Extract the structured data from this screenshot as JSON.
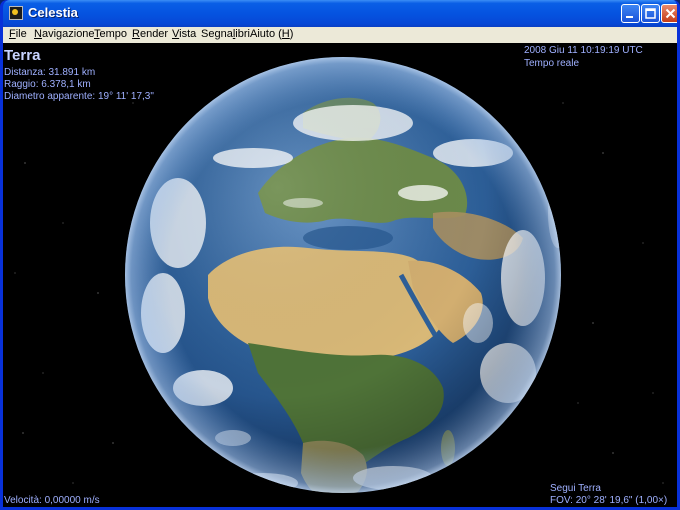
{
  "window": {
    "title": "Celestia",
    "buttons": {
      "minimize": "minimize-icon",
      "maximize": "maximize-icon",
      "close": "close-icon"
    }
  },
  "menu": {
    "items": [
      {
        "label": "File",
        "accel": "F"
      },
      {
        "label": "Navigazione",
        "accel": "N"
      },
      {
        "label": "Tempo",
        "accel": "T"
      },
      {
        "label": "Render",
        "accel": "R"
      },
      {
        "label": "Vista",
        "accel": "V"
      },
      {
        "label": "Segnalibri",
        "accel": "l"
      },
      {
        "label": "Aiuto (H)",
        "accel": "H"
      }
    ]
  },
  "hud": {
    "object_name": "Terra",
    "distance": "Distanza: 31.891 km",
    "radius": "Raggio: 6.378,1 km",
    "apparent_diameter": "Diametro apparente: 19° 11' 17,3\"",
    "datetime": "2008 Giu 11 10:19:19 UTC",
    "time_mode": "Tempo reale",
    "velocity": "Velocità: 0,00000 m/s",
    "follow": "Segui Terra",
    "fov": "FOV: 20° 28' 19,6\" (1,00×)"
  },
  "colors": {
    "hud_text": "#9fb0ff",
    "titlebar_blue": "#0553e0",
    "menubar_bg": "#ece9d8",
    "space": "#000000"
  }
}
